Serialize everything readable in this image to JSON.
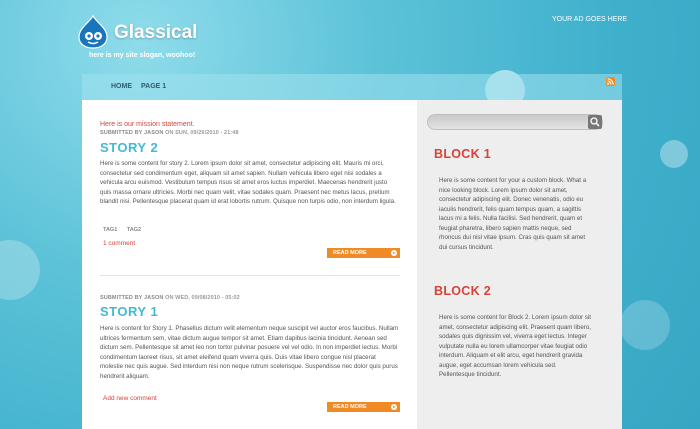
{
  "header": {
    "site_name": "Glassical",
    "slogan": "here is my site slogan, woohoo!",
    "ad_text": "YOUR AD GOES HERE",
    "logo_icon": "drupal-drop-icon"
  },
  "nav": {
    "items": [
      {
        "label": "HOME"
      },
      {
        "label": "PAGE 1"
      }
    ],
    "rss_icon": "rss-feed-icon"
  },
  "main": {
    "mission": "Here is our mission statement.",
    "posts": [
      {
        "submitted_prefix": "SUBMITTED BY JASON",
        "submitted_date": "ON SUN, 09/26/2010 - 21:48",
        "title": "STORY 2",
        "body": "Here is some content for story 2. Lorem ipsum dolor sit amet, consectetur adipiscing elit. Mauris mi orci, consectetur sed condimentum eget, aliquam sit amet sapien. Nullam vehicula libero eget nisi sodales a vehicula arcu euismod. Vestibulum tempus risus sit amet eros luctus imperdiet. Maecenas hendrerit justo quis massa ornare ultricies. Morbi nec quam velit, vitae sodales quam. Praesent nec metus lacus, pretium blandit nisi. Pellentesque placerat quam id erat lobortis rutrum. Quisque non turpis odio, non interdum ligula.",
        "tags": [
          "TAG1",
          "TAG2"
        ],
        "comment_link": "1 comment",
        "read_more": "READ MORE"
      },
      {
        "submitted_prefix": "SUBMITTED BY JASON",
        "submitted_date": "ON WED, 09/08/2010 - 05:02",
        "title": "STORY 1",
        "body": "Here is content for Story 1. Phasellus dictum velit elementum neque suscipit vel auctor eros faucibus. Nullam ultrices fermentum sem, vitae dictum augue tempor sit amet. Etiam dapibus lacinia tincidunt. Aenean sed dictum sem. Pellentesque sit amet leo non tortor pulvinar posuere vel vel odio. In non imperdiet lectus. Morbi condimentum laoreet risus, sit amet eleifend quam viverra quis. Duis vitae libero congue nisl placerat molestie nec quis augue. Sed interdum nisi non neque rutrum scelerisque. Suspendisse nec dolor quis purus hendrerit aliquam.",
        "comment_link": "Add new comment",
        "read_more": "READ MORE"
      }
    ]
  },
  "sidebar": {
    "search_placeholder": "",
    "search_icon": "search-icon",
    "blocks": [
      {
        "title": "BLOCK 1",
        "body": "Here is some content for your a custom block. What a nice looking block. Lorem ipsum dolor sit amet, consectetur adipiscing elit. Donec venenatis, odio eu iaculis hendrerit, felis quam tempus quam, a sagittis lacus mi a felis. Nulla facilisi. Sed hendrerit, quam et feugiat pharetra, libero sapien mattis neque, sed rhoncus dui nisl vitae ipsum. Cras quis quam sit amet dui cursus tincidunt."
      },
      {
        "title": "BLOCK 2",
        "body": "Here is some content for Block 2. Lorem ipsum dolor sit amet, consectetur adipiscing elit. Praesent quam libero, sodales quis dignissim vel, viverra eget lectus. Integer vulputate nulla eu lorem ullamcorper vitae feugiat odio interdum. Aliquam et elit arcu, eget hendrerit gravida augue, eget accumsan lorem vehicula sed. Pellentesque tincidunt."
      }
    ]
  },
  "colors": {
    "accent_red": "#d8423a",
    "title_blue": "#42b9d6",
    "button_orange": "#f08a24"
  }
}
